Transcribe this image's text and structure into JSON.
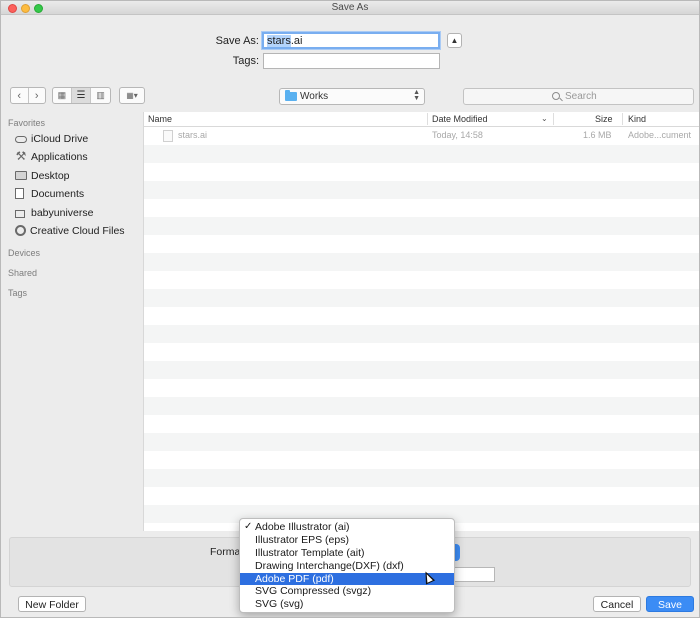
{
  "window": {
    "title": "Save As"
  },
  "save": {
    "save_as_label": "Save As:",
    "filename_selected": "stars",
    "filename_ext": ".ai",
    "tags_label": "Tags:",
    "tags_value": ""
  },
  "toolbar": {
    "location": "Works",
    "search_placeholder": "Search"
  },
  "sidebar": {
    "sections": [
      "Favorites",
      "Devices",
      "Shared",
      "Tags"
    ],
    "favorites": [
      {
        "label": "iCloud Drive",
        "icon": "cloud-icon"
      },
      {
        "label": "Applications",
        "icon": "applications-icon"
      },
      {
        "label": "Desktop",
        "icon": "desktop-icon"
      },
      {
        "label": "Documents",
        "icon": "documents-icon"
      },
      {
        "label": "babyuniverse",
        "icon": "home-icon"
      },
      {
        "label": "Creative Cloud Files",
        "icon": "creative-cloud-icon"
      }
    ]
  },
  "file_list": {
    "columns": [
      "Name",
      "Date Modified",
      "Size",
      "Kind"
    ],
    "rows": [
      {
        "name": "stars.ai",
        "date": "Today, 14:58",
        "size": "1.6 MB",
        "kind": "Adobe...cument"
      }
    ]
  },
  "format": {
    "label": "Format",
    "options": [
      "Adobe Illustrator (ai)",
      "Illustrator EPS (eps)",
      "Illustrator Template (ait)",
      "Drawing Interchange(DXF) (dxf)",
      "Adobe PDF (pdf)",
      "SVG Compressed (svgz)",
      "SVG (svg)"
    ],
    "checked_option": "Adobe Illustrator (ai)",
    "highlighted_option": "Adobe PDF (pdf)"
  },
  "buttons": {
    "new_folder": "New Folder",
    "cancel": "Cancel",
    "save": "Save"
  },
  "colors": {
    "accent": "#3b8cf5",
    "highlight": "#2d6fe0",
    "folder": "#5ab1f0"
  }
}
